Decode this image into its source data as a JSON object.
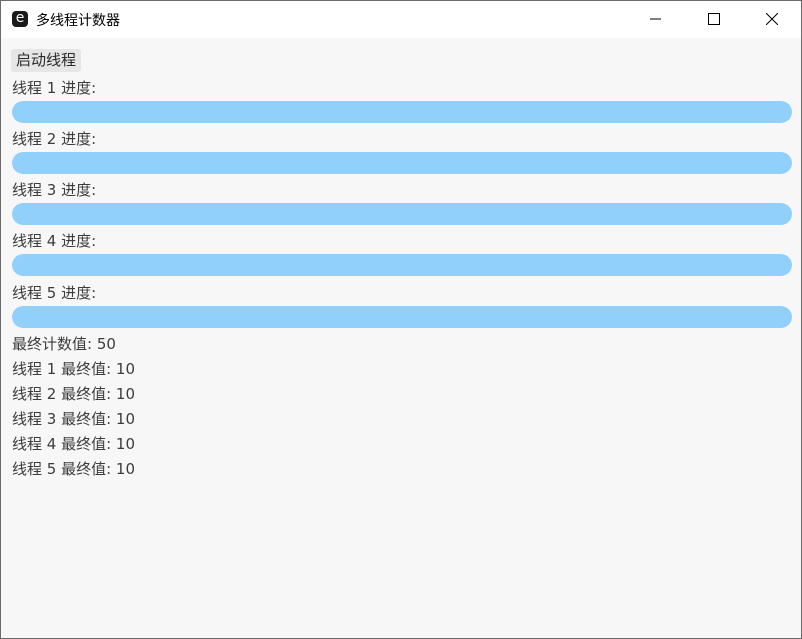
{
  "window": {
    "title": "多线程计数器",
    "app_icon_glyph": "e",
    "controls": [
      "minimize-icon",
      "maximize-icon",
      "close-icon"
    ]
  },
  "main": {
    "start_button_label": "启动线程",
    "threads": [
      {
        "label": "线程 1 进度:",
        "progress": 1.0
      },
      {
        "label": "线程 2 进度:",
        "progress": 1.0
      },
      {
        "label": "线程 3 进度:",
        "progress": 1.0
      },
      {
        "label": "线程 4 进度:",
        "progress": 1.0
      },
      {
        "label": "线程 5 进度:",
        "progress": 1.0
      }
    ],
    "final_count": "最终计数值: 50",
    "thread_results": [
      "线程 1 最终值: 10",
      "线程 2 最终值: 10",
      "线程 3 最终值: 10",
      "线程 4 最终值: 10",
      "线程 5 最终值: 10"
    ]
  },
  "colors": {
    "progress_fill": "#91d0fb",
    "window_bg": "#f7f7f7",
    "text": "#3c3c3c"
  }
}
